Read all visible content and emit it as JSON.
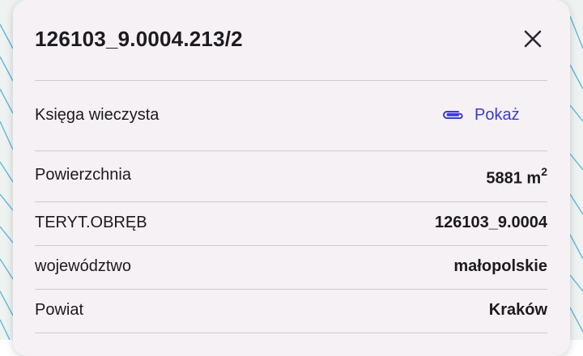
{
  "parcel": {
    "title": "126103_9.0004.213/2",
    "close_icon": "close-icon"
  },
  "land_register": {
    "label": "Księga wieczysta",
    "link_label": "Pokaż",
    "link_icon": "paperclip-icon",
    "link_color": "#3b3bd6"
  },
  "attributes": [
    {
      "label": "Powierzchnia",
      "value": "5881 m",
      "unit_sup": "2"
    },
    {
      "label": "TERYT.OBRĘB",
      "value": "126103_9.0004"
    },
    {
      "label": "województwo",
      "value": "małopolskie"
    },
    {
      "label": "Powiat",
      "value": "Kraków"
    }
  ]
}
